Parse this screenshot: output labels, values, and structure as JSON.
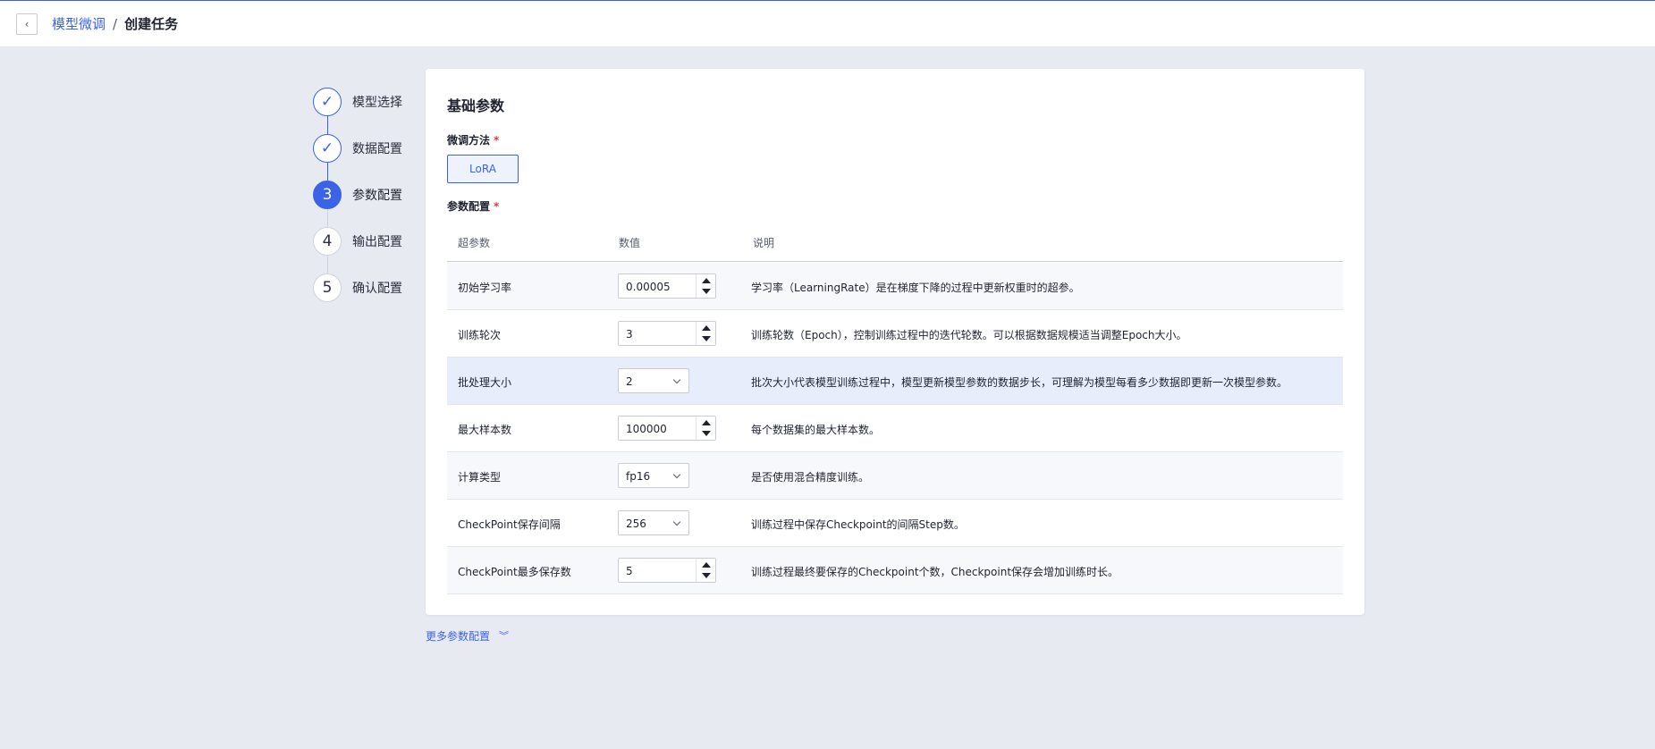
{
  "header": {
    "breadcrumb_parent": "模型微调",
    "breadcrumb_separator": "/",
    "breadcrumb_current": "创建任务",
    "back_icon": "chevron-left-icon"
  },
  "steps": [
    {
      "label": "模型选择",
      "status": "done",
      "marker": "✓"
    },
    {
      "label": "数据配置",
      "status": "done",
      "marker": "✓"
    },
    {
      "label": "参数配置",
      "status": "active",
      "marker": "3"
    },
    {
      "label": "输出配置",
      "status": "todo",
      "marker": "4"
    },
    {
      "label": "确认配置",
      "status": "todo",
      "marker": "5"
    }
  ],
  "card": {
    "title": "基础参数",
    "method_label": "微调方法",
    "required_mark": "*",
    "method_option": "LoRA",
    "params_label": "参数配置"
  },
  "table": {
    "headers": [
      "超参数",
      "数值",
      "说明"
    ],
    "rows": [
      {
        "name": "初始学习率",
        "control": "number",
        "value": "0.00005",
        "desc": "学习率（LearningRate）是在梯度下降的过程中更新权重时的超参。"
      },
      {
        "name": "训练轮次",
        "control": "number",
        "value": "3",
        "desc": "训练轮数（Epoch），控制训练过程中的迭代轮数。可以根据数据规模适当调整Epoch大小。"
      },
      {
        "name": "批处理大小",
        "control": "select",
        "value": "2",
        "desc": "批次大小代表模型训练过程中，模型更新模型参数的数据步长，可理解为模型每看多少数据即更新一次模型参数。"
      },
      {
        "name": "最大样本数",
        "control": "number",
        "value": "100000",
        "desc": "每个数据集的最大样本数。"
      },
      {
        "name": "计算类型",
        "control": "select",
        "value": "fp16",
        "desc": "是否使用混合精度训练。"
      },
      {
        "name": "CheckPoint保存间隔",
        "control": "select",
        "value": "256",
        "desc": "训练过程中保存Checkpoint的间隔Step数。"
      },
      {
        "name": "CheckPoint最多保存数",
        "control": "number",
        "value": "5",
        "desc": "训练过程最终要保存的Checkpoint个数，Checkpoint保存会增加训练时长。"
      }
    ]
  },
  "more_link": "更多参数配置",
  "colors": {
    "accent": "#3b63e8",
    "page_bg": "#e8eaf2",
    "required": "#e03b3b",
    "highlight_row": "#e8edfb"
  }
}
